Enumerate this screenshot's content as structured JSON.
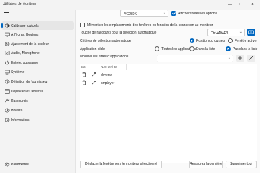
{
  "window": {
    "title": "Utilitaires de Moniteur",
    "controls": {
      "minimize": "—",
      "maximize": "□",
      "close": "✕"
    }
  },
  "sidebar": {
    "items": [
      {
        "label": "Calibrage logiciels",
        "icon": "brightness-icon",
        "active": true
      },
      {
        "label": "À l'écran, Boutons",
        "icon": "monitor-buttons-icon"
      },
      {
        "label": "Ajustement de la couleur",
        "icon": "palette-icon"
      },
      {
        "label": "Audio, Microphone",
        "icon": "speaker-icon"
      },
      {
        "label": "Entrée, puissance",
        "icon": "power-icon"
      },
      {
        "label": "Système",
        "icon": "system-icon"
      },
      {
        "label": "Définition du fournisseur",
        "icon": "info-icon"
      },
      {
        "label": "Déplacer les fenêtres",
        "icon": "window-move-icon"
      },
      {
        "label": "Raccourcis",
        "icon": "shortcut-icon"
      },
      {
        "label": "Horaire",
        "icon": "clock-icon"
      },
      {
        "label": "Informations",
        "icon": "info-circle-icon"
      }
    ],
    "settings_label": "Paramètres"
  },
  "content": {
    "monitor_select": "VG280K",
    "show_all_options": "Afficher toutes les options",
    "remember_positions": "Mémoriser les emplacements des fenêtres en fonction de la connexion au moniteur",
    "hotkey_label": "Touche de raccourci pour la sélection automatique",
    "hotkey_value": "Ctrl+Alt+F3",
    "criteria_label": "Critères de sélection automatique",
    "criteria_options": [
      "Position du curseur",
      "Fenêtre active"
    ],
    "target_app_label": "Application cible",
    "target_app_options": [
      "Toutes les applications",
      "Dans la liste",
      "Pas dans la liste"
    ],
    "modify_filters_label": "Modifier les filtres d'applications",
    "filter_input_value": "",
    "table": {
      "headers": [
        "Ba",
        "Nom de l'ap"
      ],
      "rows": [
        {
          "name": "devenv"
        },
        {
          "name": "smplayer"
        }
      ]
    },
    "footer": {
      "move_button": "Déplacer la fenêtre vers le moniteur sélectionné",
      "restore_button": "Restaurez la dernière",
      "delete_all_button": "Supprimer tout"
    }
  },
  "colors": {
    "accent": "#0067c0"
  }
}
